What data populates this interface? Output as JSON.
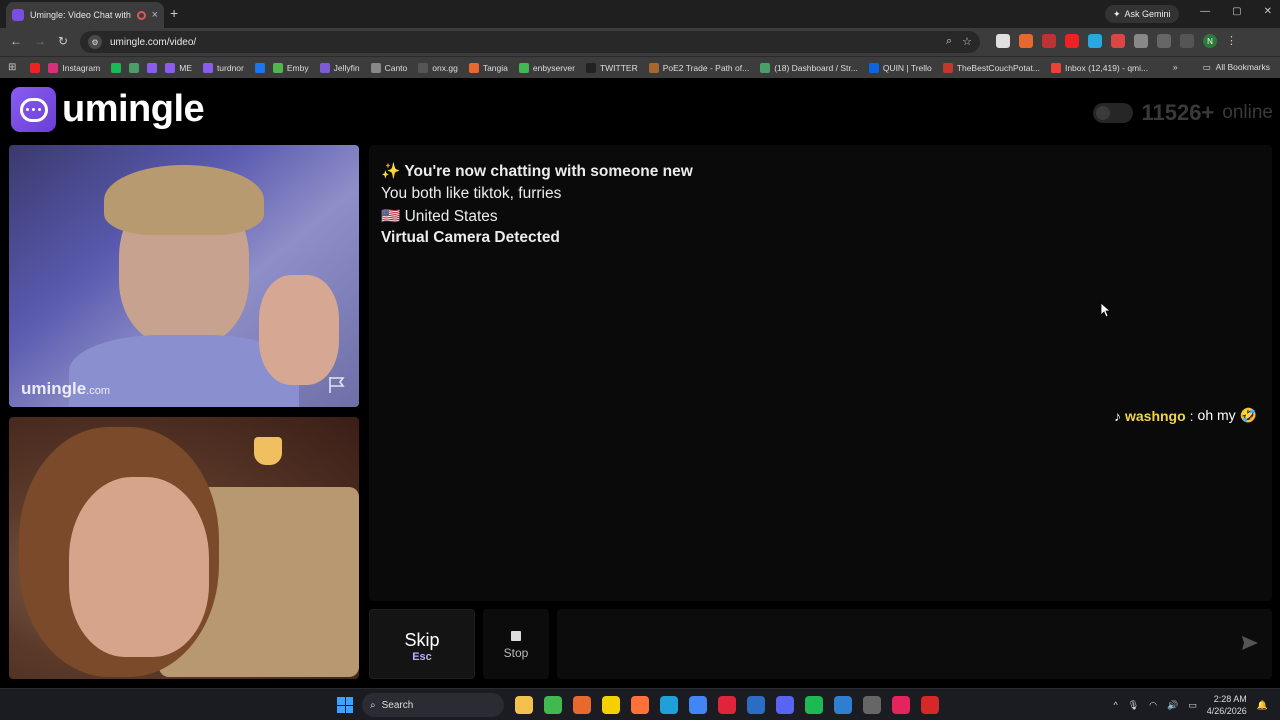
{
  "browser": {
    "tab_title": "Umingle: Video Chat with S",
    "new_tab": "+",
    "close_tab": "×",
    "ask_gemini": "Ask Gemini",
    "url": "umingle.com/video/",
    "window_controls": [
      "—",
      "▢",
      "✕"
    ],
    "bookmarks": [
      {
        "label": "",
        "color": "#e22"
      },
      {
        "label": "Instagram",
        "color": "#d6307a"
      },
      {
        "label": "",
        "color": "#1db954"
      },
      {
        "label": "",
        "color": "#4b9e6a"
      },
      {
        "label": "",
        "color": "#8a5cf0"
      },
      {
        "label": "ME",
        "color": "#8a5cf0"
      },
      {
        "label": "turdnor",
        "color": "#8a5cf0"
      },
      {
        "label": "",
        "color": "#1877f2"
      },
      {
        "label": "Emby",
        "color": "#52b54b"
      },
      {
        "label": "Jellyfin",
        "color": "#7d5bd6"
      },
      {
        "label": "Canto",
        "color": "#888888"
      },
      {
        "label": "onx.gg",
        "color": "#555555"
      },
      {
        "label": "Tangia",
        "color": "#e8692d"
      },
      {
        "label": "enbyserver",
        "color": "#3fb950"
      },
      {
        "label": "TWITTER",
        "color": "#222222"
      },
      {
        "label": "PoE2 Trade - Path of...",
        "color": "#a8682d"
      },
      {
        "label": "(18) Dashboard / Str...",
        "color": "#4b9e6a"
      },
      {
        "label": "QUIN | Trello",
        "color": "#0c66e4"
      },
      {
        "label": "TheBestCouchPotat...",
        "color": "#c0392b"
      },
      {
        "label": "Inbox (12,419) - qmi...",
        "color": "#ea4335"
      }
    ],
    "all_bookmarks": "All Bookmarks",
    "more": "»"
  },
  "site": {
    "logo_text": "umingle",
    "online_count": "11526+",
    "online_label": "online"
  },
  "stranger_video": {
    "brand": "umingle",
    "brand_suffix": ".com"
  },
  "chat": {
    "lines": [
      "✨ You're now chatting with someone new",
      "You both like tiktok, furries",
      "🇺🇸 United States",
      "Virtual Camera Detected"
    ],
    "message": {
      "icon": "♪",
      "user": "washngo",
      "separator": ":",
      "text": "oh my 🤣"
    }
  },
  "controls": {
    "skip_label": "Skip",
    "skip_key": "Esc",
    "stop_label": "Stop",
    "input_placeholder": ""
  },
  "taskbar": {
    "search_label": "Search",
    "time": "2:28 AM",
    "date": "4/26/2026",
    "tray_up": "^"
  },
  "colors": {
    "brand": "#7a4ee0",
    "username": "#f1d34a",
    "skip_key": "#b9b0ff"
  }
}
